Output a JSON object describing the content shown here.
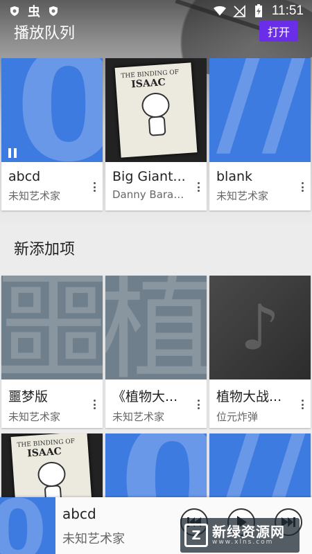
{
  "status_bar": {
    "time": "11:51"
  },
  "queue_section": {
    "title": "播放队列",
    "open_label": "打开"
  },
  "queue_items": [
    {
      "title": "abcd",
      "artist": "未知艺术家",
      "art": "blue",
      "glyph": "♪",
      "playing": true
    },
    {
      "title": "Big Giant...",
      "artist": "Danny Baran...",
      "art": "isaac",
      "glyph": "",
      "playing": false
    },
    {
      "title": "blank",
      "artist": "未知艺术家",
      "art": "blue",
      "glyph": "//",
      "playing": false
    }
  ],
  "new_section": {
    "title": "新添加项"
  },
  "new_items": [
    {
      "title": "噩梦版",
      "artist": "未知艺术家",
      "art": "gray",
      "glyph": "噩"
    },
    {
      "title": "《植物大...",
      "artist": "未知艺术家",
      "art": "gray",
      "glyph": "植"
    },
    {
      "title": "植物大战...",
      "artist": "位元炸弹",
      "art": "dark",
      "glyph": "♪"
    }
  ],
  "now_playing": {
    "title": "abcd",
    "artist": "未知艺术家"
  },
  "watermark": {
    "name": "新绿资源网",
    "url": "www.xlns.com"
  },
  "colors": {
    "accent": "#6a2ee8",
    "album_blue": "#3e7be0"
  }
}
